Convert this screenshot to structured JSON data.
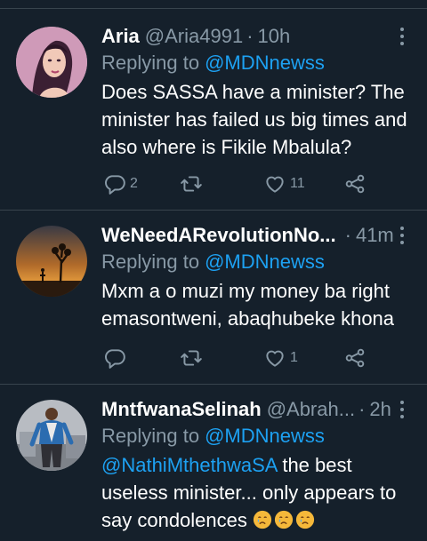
{
  "tweets": [
    {
      "name": "Aria",
      "handle": "@Aria4991",
      "dot": "·",
      "time": "10h",
      "replying_label": "Replying to",
      "replying_to": "@MDNnewss",
      "text": "Does SASSA have a minister? The minister has failed us big times and also where is Fikile Mbalula?",
      "replies": "2",
      "retweets": "",
      "likes": "11"
    },
    {
      "name": "WeNeedARevolutionNo...",
      "handle": "",
      "dot": "·",
      "time": "41m",
      "replying_label": "Replying to",
      "replying_to": "@MDNnewss",
      "text": "Mxm a o muzi my money ba right emasontweni, abaqhubeke khona",
      "replies": "",
      "retweets": "",
      "likes": "1"
    },
    {
      "name": "MntfwanaSelinah",
      "handle": "@Abrah...",
      "dot": "·",
      "time": "2h",
      "replying_label": "Replying to",
      "replying_to": "@MDNnewss",
      "mention": "@NathiMthethwaSA",
      "text": " the best useless minister... only appears to say condolences",
      "emoji": "crying-face-emoji"
    }
  ],
  "colors": {
    "background": "#15202b",
    "secondary_text": "#8899a6",
    "link": "#1da1f2",
    "divider": "#38444d"
  },
  "icons": [
    "reply-icon",
    "retweet-icon",
    "like-icon",
    "share-icon",
    "more-icon"
  ]
}
